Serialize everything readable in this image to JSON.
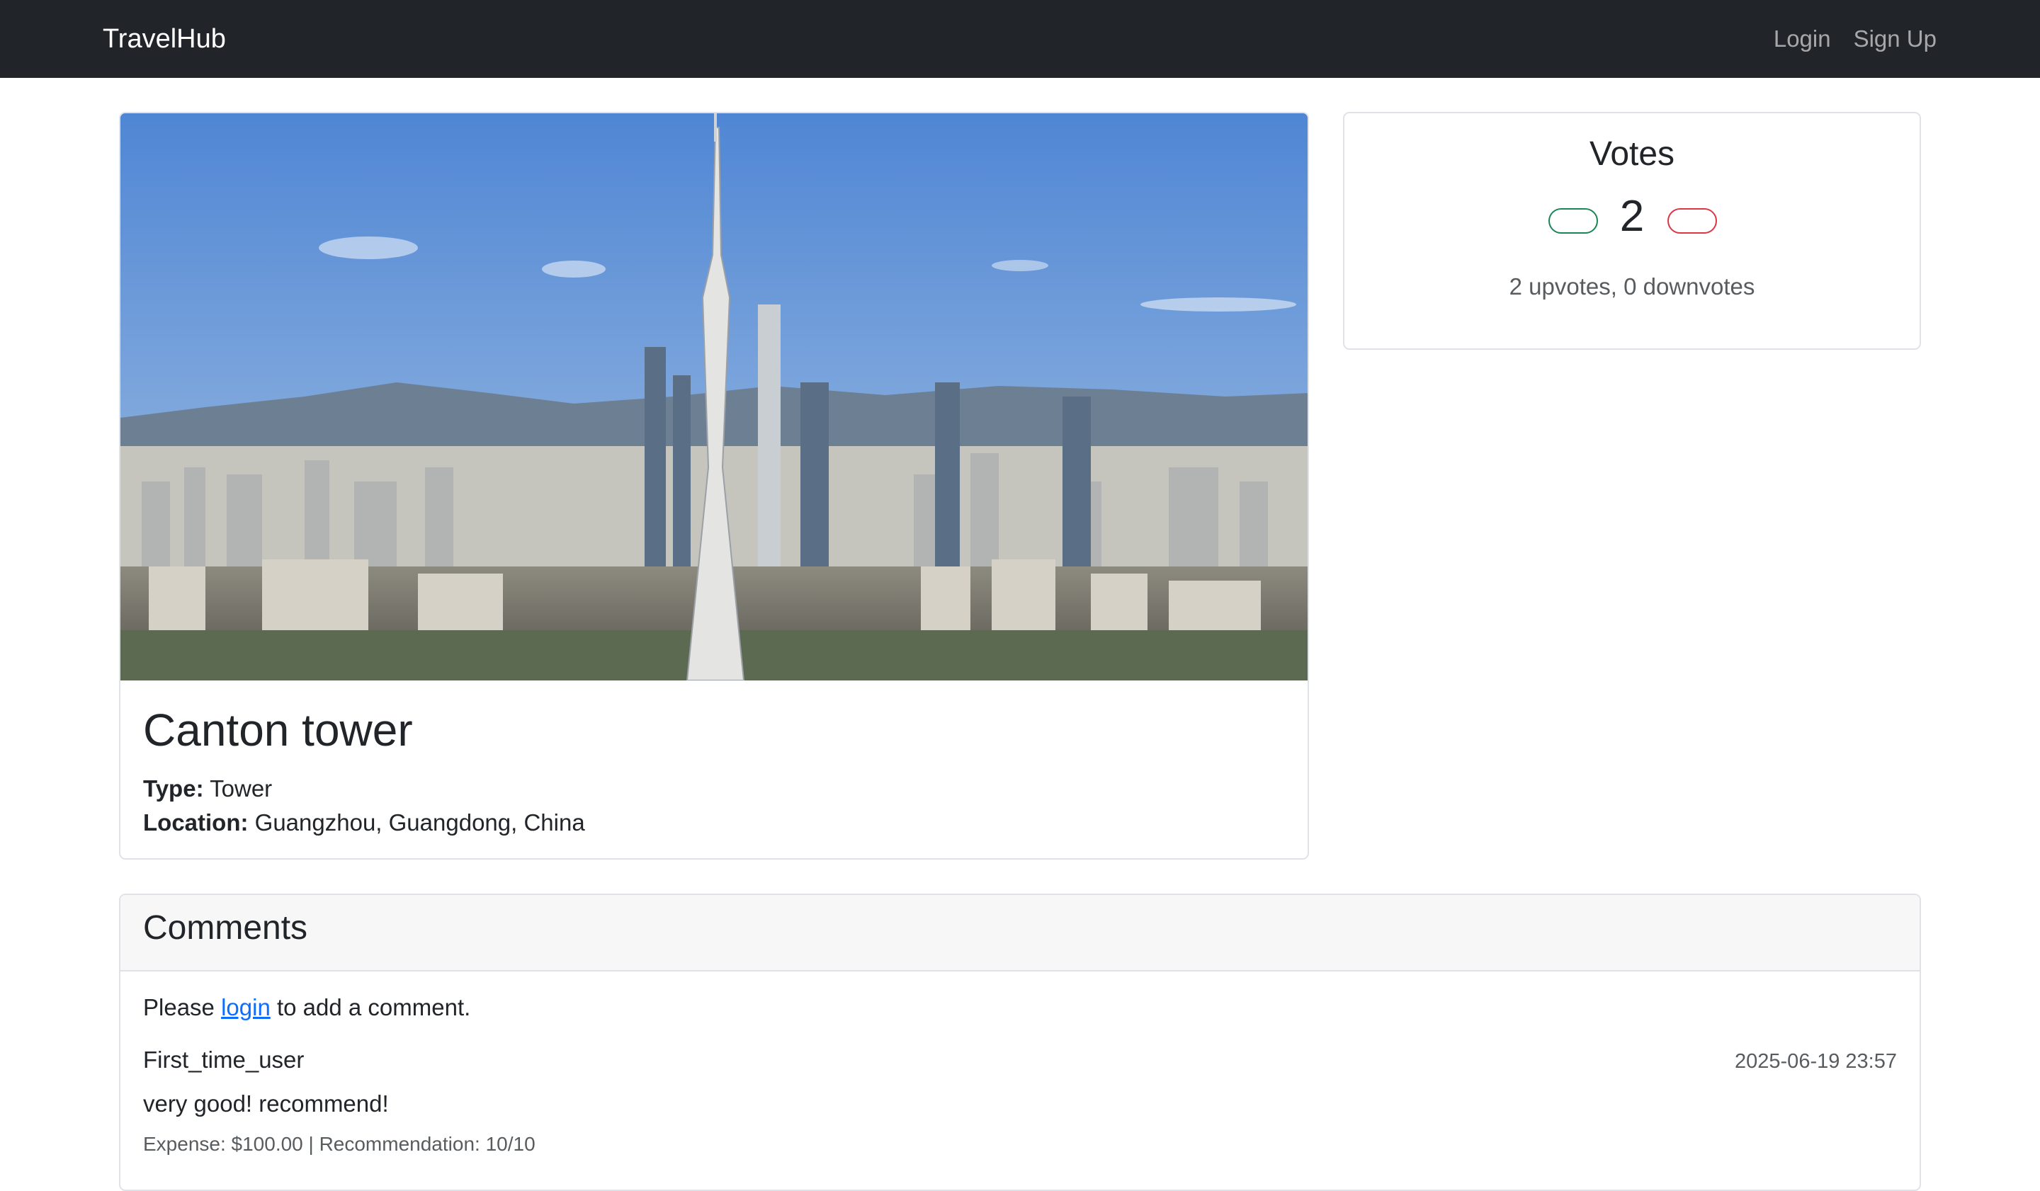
{
  "navbar": {
    "brand": "TravelHub",
    "links": [
      "Login",
      "Sign Up"
    ]
  },
  "place": {
    "name": "Canton tower",
    "type_label": "Type:",
    "type_value": "Tower",
    "location_label": "Location:",
    "location_value": "Guangzhou, Guangdong, China"
  },
  "votes": {
    "title": "Votes",
    "score": "2",
    "summary": "2 upvotes, 0 downvotes",
    "up_color": "#198754",
    "down_color": "#dc3545"
  },
  "comments": {
    "title": "Comments",
    "prompt_before": "Please ",
    "prompt_link": "login",
    "prompt_after": " to add a comment.",
    "items": [
      {
        "user": "First_time_user",
        "time": "2025-06-19 23:57",
        "text": "very good! recommend!",
        "meta": "Expense: $100.00 | Recommendation: 10/10"
      }
    ]
  }
}
